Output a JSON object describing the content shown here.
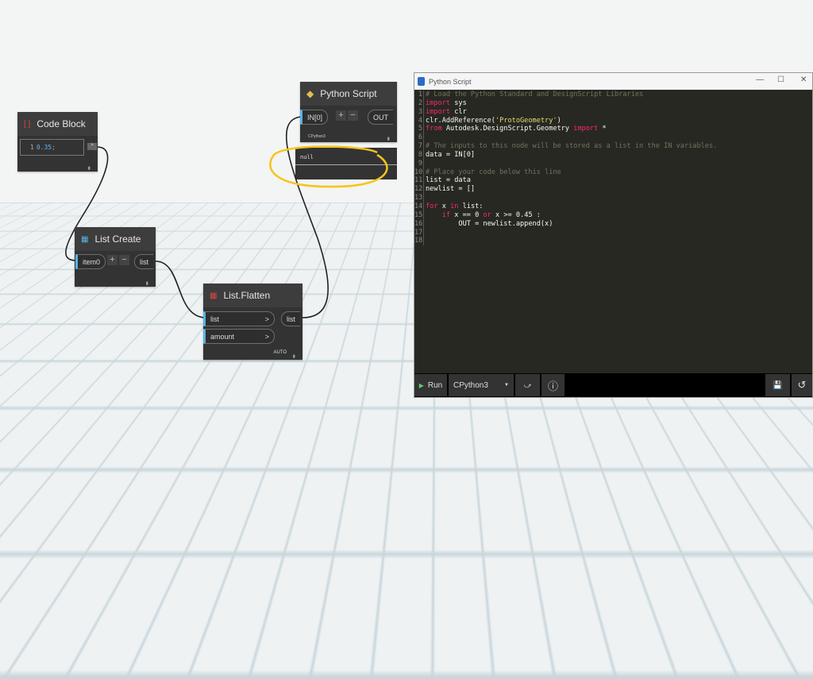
{
  "nodes": {
    "code_block": {
      "title": "Code Block",
      "line": "1",
      "value": "0.35;"
    },
    "python_script": {
      "title": "Python Script",
      "input": "IN[0]",
      "output": "OUT",
      "engine": "CPython3",
      "preview": "null"
    },
    "list_create": {
      "title": "List Create",
      "input": "item0",
      "output": "list"
    },
    "list_flatten": {
      "title": "List.Flatten",
      "inputs": [
        "list",
        "amount"
      ],
      "output": "list",
      "lacing": "AUTO"
    }
  },
  "editor": {
    "title": "Python Script",
    "lines": [
      "# Load the Python Standard and DesignScript Libraries",
      "import sys",
      "import clr",
      "clr.AddReference('ProtoGeometry')",
      "from Autodesk.DesignScript.Geometry import *",
      "",
      "# The inputs to this node will be stored as a list in the IN variables.",
      "data = IN[0]",
      "",
      "# Place your code below this line",
      "list = data",
      "newlist = []",
      "",
      "for x in list:",
      "    if x == 0 or x >= 0.45 :",
      "        OUT = newlist.append(x)",
      "",
      ""
    ],
    "toolbar": {
      "run": "Run",
      "engine": "CPython3"
    }
  },
  "colors": {
    "accent": "#59b2e6",
    "highlight": "#f5c518",
    "keyword": "#f92672",
    "comment": "#75715e",
    "string": "#e6db74",
    "number": "#ae81ff"
  }
}
